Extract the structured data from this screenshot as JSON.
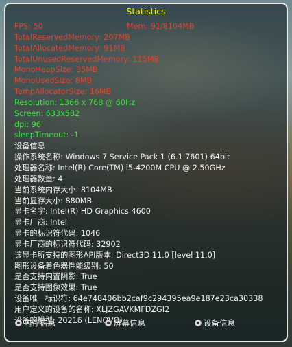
{
  "window": {
    "title": "Statistics"
  },
  "stats": {
    "fps": "FPS: 50",
    "mem": "Mem: 91/8104MB",
    "red_lines": [
      "TotalReservedMemory: 207MB",
      "TotalAllocatedMemory: 91MB",
      "TotalUnusedReservedMemory: 115MB",
      "MonoHeapSize: 35MB",
      "MonoUsedSize: 8MB",
      "TempAllocatorSize: 16MB"
    ],
    "green_lines": [
      "Resolution: 1366 x 768 @ 60Hz",
      "Screen: 633x582",
      "dpi: 96",
      "sleepTimeout: -1"
    ]
  },
  "device_info": {
    "header": "设备信息",
    "lines": [
      "操作系统名称: Windows 7 Service Pack 1 (6.1.7601) 64bit",
      "处理器名称: Intel(R) Core(TM) i5-4200M CPU @ 2.50GHz",
      "处理器数量: 4",
      "当前系统内存大小: 8104MB",
      "当前显存大小: 880MB",
      "显卡名字: Intel(R) HD Graphics 4600",
      "显卡厂商: Intel",
      "显卡的标识符代码: 1046",
      "显卡厂商的标识符代码: 32902",
      "该显卡所支持的图形API版本: Direct3D 11.0 [level 11.0]",
      "图形设备着色器性能级别: 50",
      "是否支持内置阴影: True",
      "是否支持图像效果: True",
      "设备唯一标识符: 64e748406bb2caf9c294395ea9e187e23ca30338",
      "用户定义的设备的名称: XLJZGAVKMFDZGI2",
      "设备的模型: 20216 (LENOVO)"
    ]
  },
  "tabs": [
    {
      "label": "内存信息"
    },
    {
      "label": "屏幕信息"
    },
    {
      "label": "设备信息"
    }
  ],
  "colors": {
    "title": "#f3f31b",
    "memory_text": "#e2442a",
    "screen_text": "#3ee23e",
    "device_text": "#f2f2f2"
  }
}
